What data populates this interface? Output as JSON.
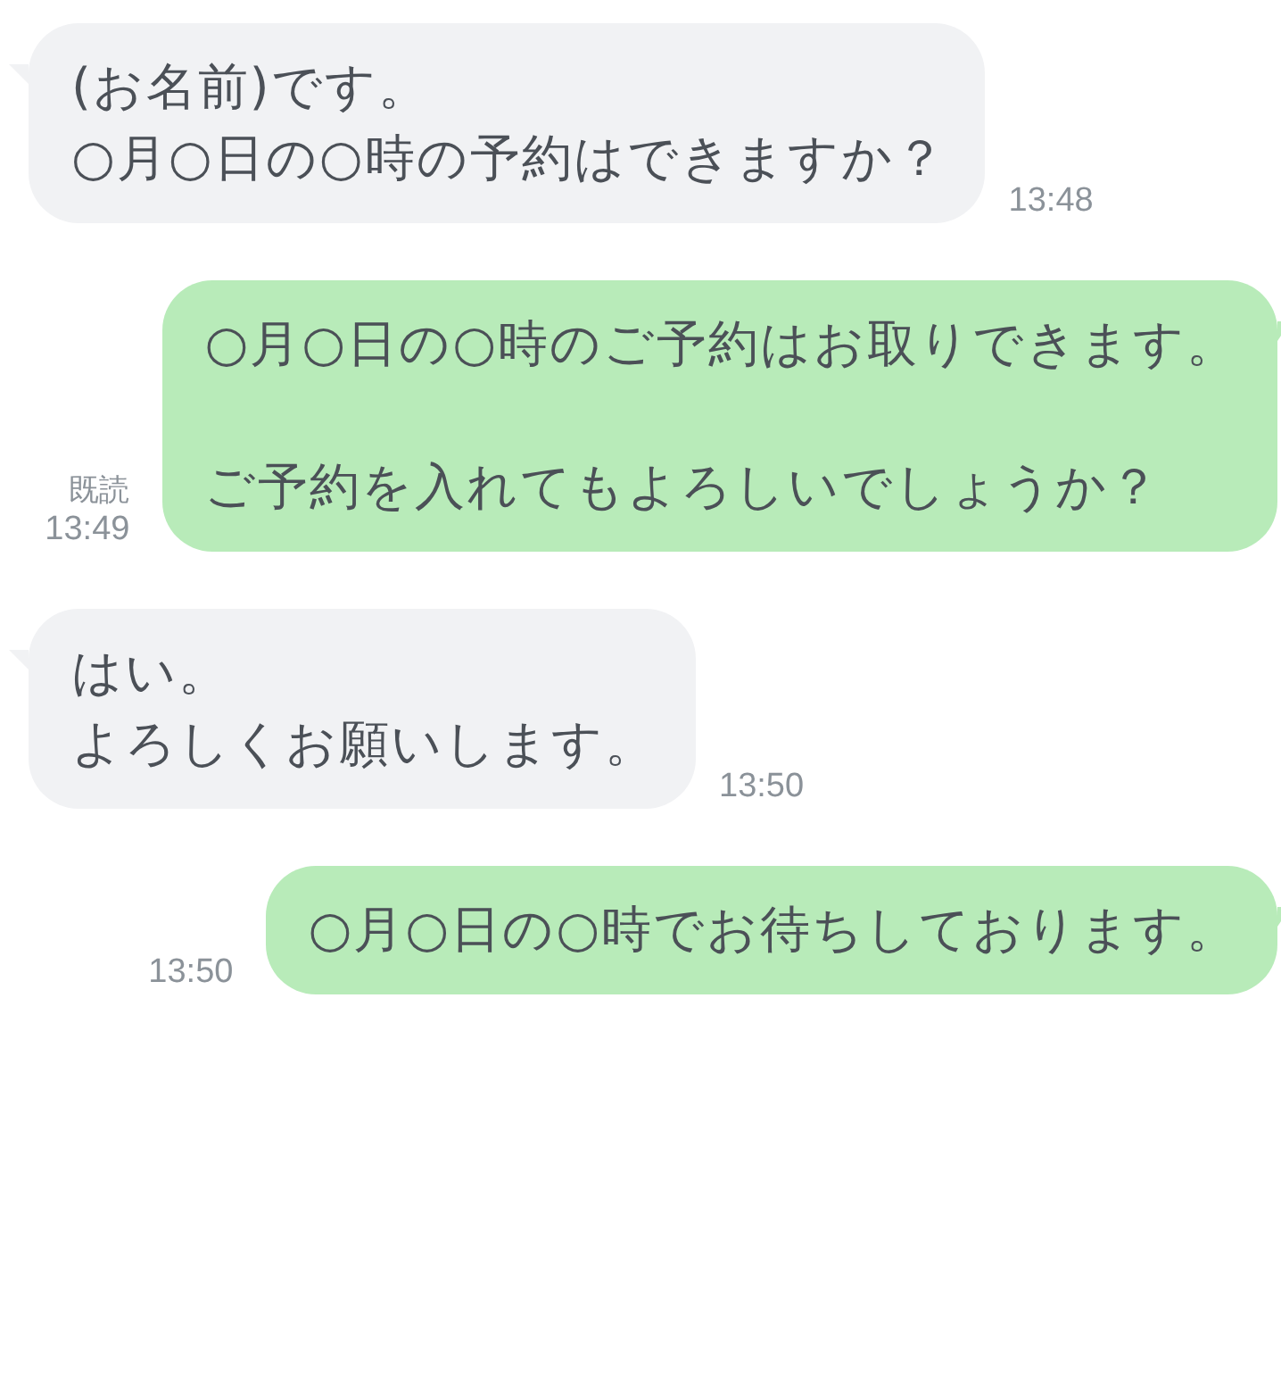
{
  "messages": [
    {
      "kind": "received",
      "paragraphs": [
        [
          "(お名前)です。",
          "○月○日の○時の予約はできますか？"
        ]
      ],
      "time": "13:48"
    },
    {
      "kind": "sent",
      "paragraphs": [
        [
          "○月○日の○時のご予約はお取りできます。"
        ],
        [
          "ご予約を入れてもよろしいでしょうか？"
        ]
      ],
      "read_label": "既読",
      "time": "13:49"
    },
    {
      "kind": "received",
      "paragraphs": [
        [
          "はい。",
          "よろしくお願いします。"
        ]
      ],
      "time": "13:50"
    },
    {
      "kind": "sent",
      "paragraphs": [
        [
          "○月○日の○時でお待ちしております。"
        ]
      ],
      "time": "13:50"
    }
  ]
}
